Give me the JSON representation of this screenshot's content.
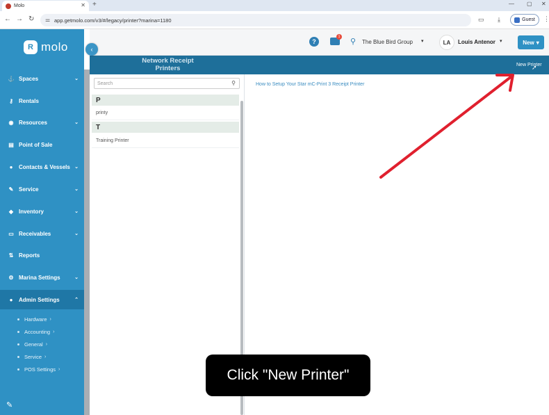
{
  "browser": {
    "tab_title": "Molo",
    "url": "app.getmolo.com/v3/#/legacy/printer?marina=1180",
    "profile_label": "Guest",
    "new_tab_symbol": "+",
    "close_symbol": "✕"
  },
  "sidebar": {
    "logo_text": "molo",
    "logo_mark": "R",
    "items": [
      {
        "label": "Spaces",
        "icon": "anchor-icon",
        "glyph": "⚓",
        "has_chevron": true
      },
      {
        "label": "Rentals",
        "icon": "key-icon",
        "glyph": "🔑",
        "has_chevron": false
      },
      {
        "label": "Resources",
        "icon": "resources-icon",
        "glyph": "◉",
        "has_chevron": true
      },
      {
        "label": "Point of Sale",
        "icon": "pos-icon",
        "glyph": "▤",
        "has_chevron": false
      },
      {
        "label": "Contacts & Vessels",
        "icon": "contacts-icon",
        "glyph": "👤",
        "has_chevron": true
      },
      {
        "label": "Service",
        "icon": "wrench-icon",
        "glyph": "✎",
        "has_chevron": true
      },
      {
        "label": "Inventory",
        "icon": "tag-icon",
        "glyph": "◆",
        "has_chevron": true
      },
      {
        "label": "Receivables",
        "icon": "card-icon",
        "glyph": "▭",
        "has_chevron": true
      },
      {
        "label": "Reports",
        "icon": "sort-icon",
        "glyph": "⇅",
        "has_chevron": false
      },
      {
        "label": "Marina Settings",
        "icon": "gear-icon",
        "glyph": "⚙",
        "has_chevron": true
      },
      {
        "label": "Admin Settings",
        "icon": "admin-icon",
        "glyph": "👥",
        "has_chevron": true
      }
    ],
    "sub_items": [
      {
        "label": "Hardware"
      },
      {
        "label": "Accounting"
      },
      {
        "label": "General"
      },
      {
        "label": "Service"
      },
      {
        "label": "POS Settings"
      }
    ]
  },
  "header": {
    "org_name": "The Blue Bird Group",
    "user_initials": "LA",
    "user_name": "Louis Antenor",
    "new_button_label": "New",
    "notification_count": "1",
    "help_symbol": "?"
  },
  "page": {
    "title": "Network Receipt Printers",
    "new_printer_label": "New Printer",
    "search_placeholder": "Search",
    "groups": [
      {
        "letter": "P",
        "items": [
          "printy"
        ]
      },
      {
        "letter": "T",
        "items": [
          "Training Printer"
        ]
      }
    ],
    "help_link": "How to Setup Your Star mC-Print 3 Receipt Printer"
  },
  "overlay": {
    "caption": "Click \"New Printer\"",
    "arrow_color": "#e0202e"
  }
}
